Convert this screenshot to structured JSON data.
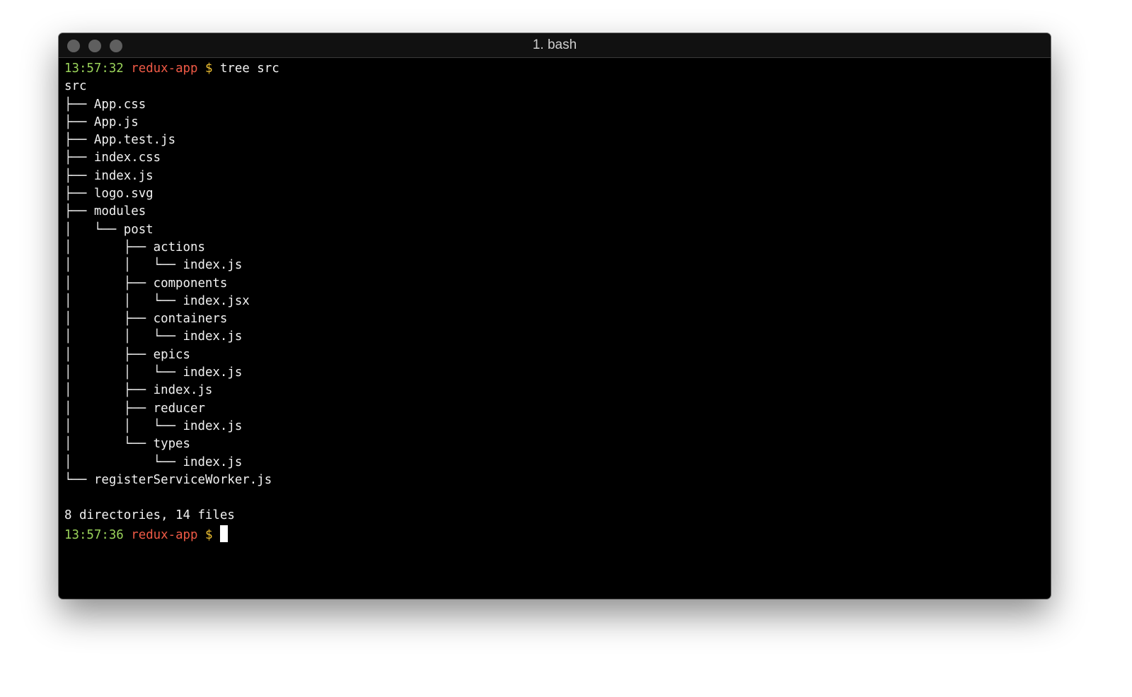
{
  "window": {
    "title": "1. bash"
  },
  "prompt1": {
    "time": "13:57:32",
    "host": "redux-app",
    "symbol": "$",
    "command": "tree src"
  },
  "tree": [
    {
      "prefix": "",
      "name": "src"
    },
    {
      "prefix": "├── ",
      "name": "App.css"
    },
    {
      "prefix": "├── ",
      "name": "App.js"
    },
    {
      "prefix": "├── ",
      "name": "App.test.js"
    },
    {
      "prefix": "├── ",
      "name": "index.css"
    },
    {
      "prefix": "├── ",
      "name": "index.js"
    },
    {
      "prefix": "├── ",
      "name": "logo.svg"
    },
    {
      "prefix": "├── ",
      "name": "modules"
    },
    {
      "prefix": "│   └── ",
      "name": "post"
    },
    {
      "prefix": "│       ├── ",
      "name": "actions"
    },
    {
      "prefix": "│       │   └── ",
      "name": "index.js"
    },
    {
      "prefix": "│       ├── ",
      "name": "components"
    },
    {
      "prefix": "│       │   └── ",
      "name": "index.jsx"
    },
    {
      "prefix": "│       ├── ",
      "name": "containers"
    },
    {
      "prefix": "│       │   └── ",
      "name": "index.js"
    },
    {
      "prefix": "│       ├── ",
      "name": "epics"
    },
    {
      "prefix": "│       │   └── ",
      "name": "index.js"
    },
    {
      "prefix": "│       ├── ",
      "name": "index.js"
    },
    {
      "prefix": "│       ├── ",
      "name": "reducer"
    },
    {
      "prefix": "│       │   └── ",
      "name": "index.js"
    },
    {
      "prefix": "│       └── ",
      "name": "types"
    },
    {
      "prefix": "│           └── ",
      "name": "index.js"
    },
    {
      "prefix": "└── ",
      "name": "registerServiceWorker.js"
    }
  ],
  "summary": "8 directories, 14 files",
  "prompt2": {
    "time": "13:57:36",
    "host": "redux-app",
    "symbol": "$"
  },
  "colors": {
    "time": "#9ad35a",
    "host": "#f05a46",
    "dollar": "#f1c232",
    "background": "#000000"
  }
}
